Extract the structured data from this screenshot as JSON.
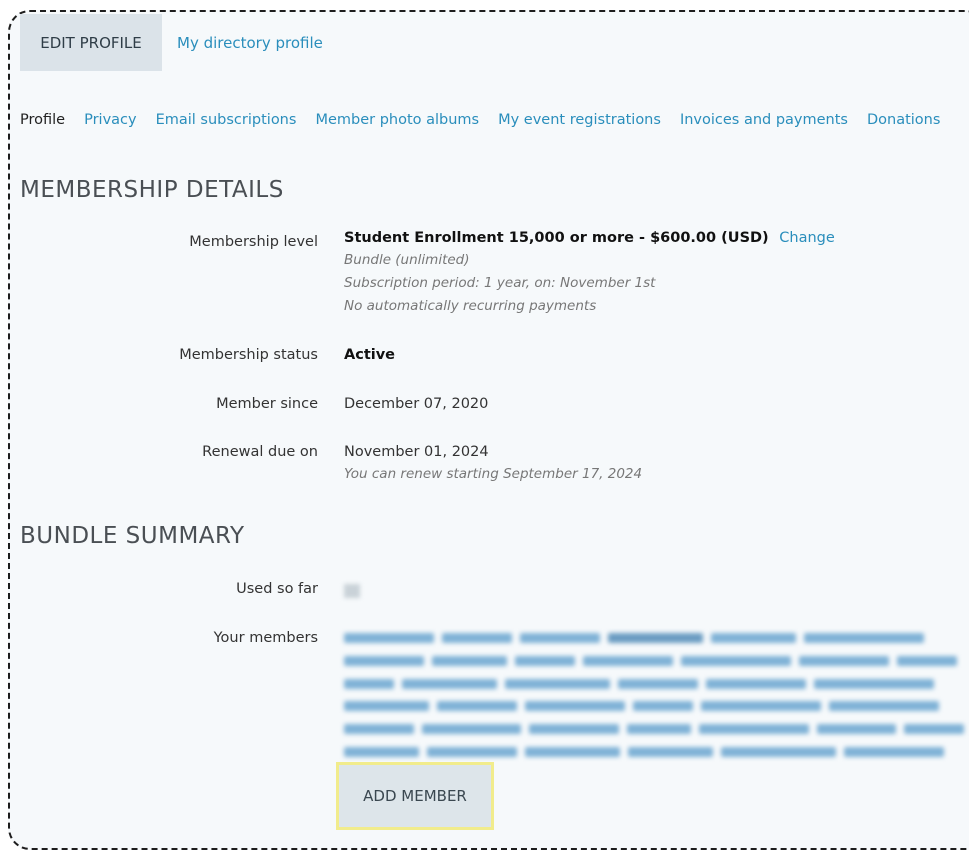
{
  "tabs": [
    {
      "label": "EDIT PROFILE",
      "active": true
    },
    {
      "label": "My directory profile",
      "active": false
    }
  ],
  "subnav": [
    {
      "label": "Profile",
      "current": true
    },
    {
      "label": "Privacy"
    },
    {
      "label": "Email subscriptions"
    },
    {
      "label": "Member photo albums"
    },
    {
      "label": "My event registrations"
    },
    {
      "label": "Invoices and payments"
    },
    {
      "label": "Donations"
    }
  ],
  "membership": {
    "heading": "MEMBERSHIP DETAILS",
    "level_label": "Membership level",
    "level_value": "Student Enrollment 15,000 or more - $600.00 (USD)",
    "change_link": "Change",
    "bundle_note": "Bundle (unlimited)",
    "subscription_note": "Subscription period: 1 year, on: November 1st",
    "recurring_note": "No automatically recurring payments",
    "status_label": "Membership status",
    "status_value": "Active",
    "since_label": "Member since",
    "since_value": "December 07, 2020",
    "renewal_label": "Renewal due on",
    "renewal_value": "November 01, 2024",
    "renewal_note": "You can renew starting September 17, 2024"
  },
  "bundle": {
    "heading": "BUNDLE SUMMARY",
    "used_label": "Used so far",
    "members_label": "Your members",
    "add_button": "ADD MEMBER"
  },
  "colors": {
    "link": "#2a8ebc",
    "tab_active_bg": "#dbe3e9",
    "button_highlight": "#f1ec8c"
  }
}
